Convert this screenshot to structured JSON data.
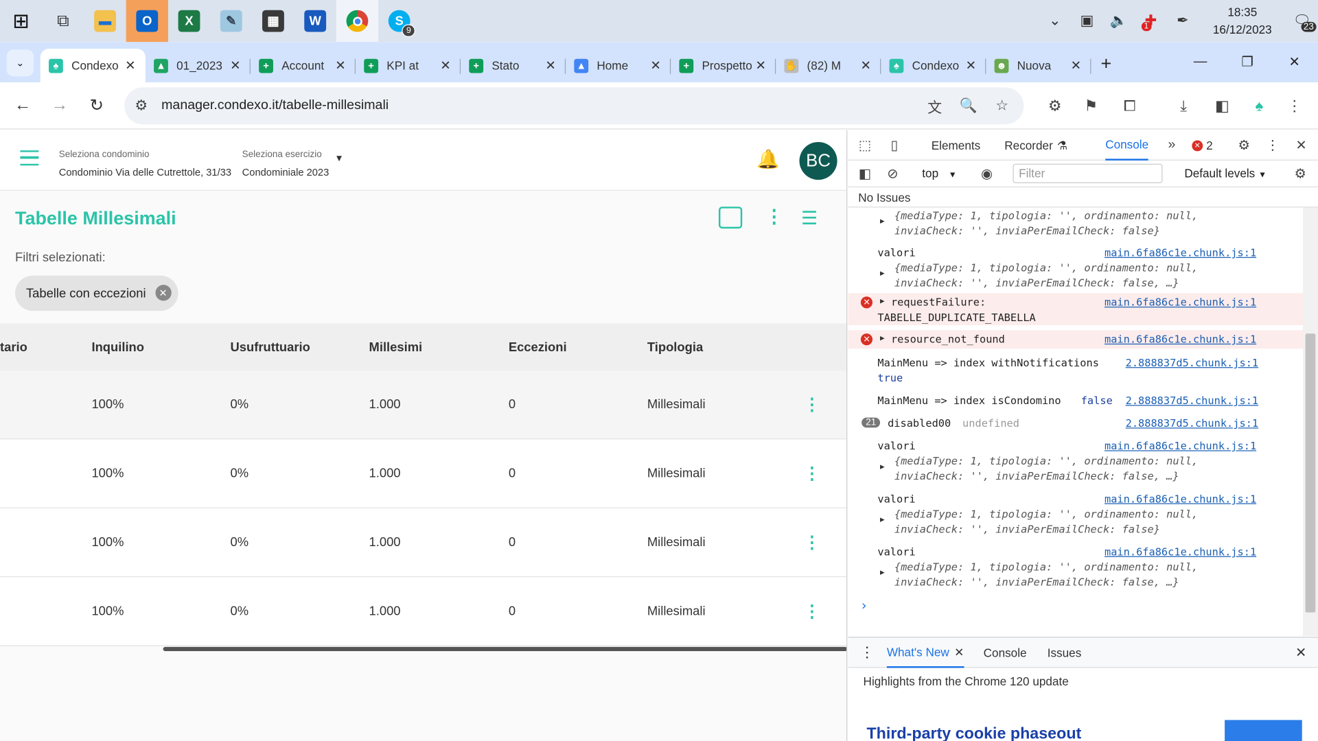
{
  "taskbar": {
    "apps": [
      {
        "name": "start",
        "glyph": "⊞"
      },
      {
        "name": "task-view",
        "glyph": "⧉"
      },
      {
        "name": "file-explorer",
        "glyph": "📁"
      },
      {
        "name": "outlook",
        "glyph": "O"
      },
      {
        "name": "excel",
        "glyph": "X"
      },
      {
        "name": "notepad",
        "glyph": "✎"
      },
      {
        "name": "calculator",
        "glyph": "▦"
      },
      {
        "name": "word",
        "glyph": "W"
      },
      {
        "name": "chrome",
        "glyph": "◉"
      },
      {
        "name": "skype",
        "glyph": "S",
        "badge": "9"
      }
    ],
    "time": "18:35",
    "date": "16/12/2023",
    "notification_count": "23",
    "mail_badge": "1"
  },
  "browser": {
    "tabs": [
      {
        "title": "Condexo",
        "color": "#2bc4a8",
        "glyph": "♠",
        "active": true
      },
      {
        "title": "01_2023",
        "color": "#1fa463",
        "glyph": "▲",
        "active": false
      },
      {
        "title": "Account",
        "color": "#0f9d58",
        "glyph": "+",
        "active": false
      },
      {
        "title": "KPI at",
        "color": "#0f9d58",
        "glyph": "+",
        "active": false
      },
      {
        "title": "Stato",
        "color": "#0f9d58",
        "glyph": "+",
        "active": false
      },
      {
        "title": "Home",
        "color": "#4285f4",
        "glyph": "▲",
        "active": false
      },
      {
        "title": "Prospetto",
        "color": "#0f9d58",
        "glyph": "+",
        "active": false
      },
      {
        "title": "(82) M",
        "color": "#bbbbbb",
        "glyph": "✋",
        "active": false
      },
      {
        "title": "Condexo",
        "color": "#2bc4a8",
        "glyph": "♠",
        "active": false
      },
      {
        "title": "Nuova",
        "color": "#6aa84f",
        "glyph": "☻",
        "active": false
      }
    ],
    "url": "manager.condexo.it/tabelle-millesimali"
  },
  "app": {
    "condominio_label": "Seleziona condominio",
    "condominio_value": "Condominio Via delle Cutrettole, 31/33",
    "esercizio_label": "Seleziona esercizio",
    "esercizio_value": "Condominiale 2023",
    "avatar": "BC",
    "title": "Tabelle Millesimali",
    "filters_label": "Filtri selezionati:",
    "chip": "Tabelle con eccezioni",
    "columns": [
      "tario",
      "Inquilino",
      "Usufruttuario",
      "Millesimi",
      "Eccezioni",
      "Tipologia"
    ],
    "rows": [
      [
        "100%",
        "0%",
        "1.000",
        "0",
        "Millesimali"
      ],
      [
        "100%",
        "0%",
        "1.000",
        "0",
        "Millesimali"
      ],
      [
        "100%",
        "0%",
        "1.000",
        "0",
        "Millesimali"
      ],
      [
        "100%",
        "0%",
        "1.000",
        "0",
        "Millesimali"
      ]
    ],
    "accent": "#2bc4a8"
  },
  "devtools": {
    "tabs": [
      "Elements",
      "Recorder",
      "Console"
    ],
    "active_tab": "Console",
    "error_count": "2",
    "context": "top",
    "filter_placeholder": "Filter",
    "levels": "Default levels",
    "no_issues": "No Issues",
    "drawer_tabs": [
      "What's New",
      "Console",
      "Issues"
    ],
    "highlights": "Highlights from the Chrome 120 update",
    "promo_title": "Third-party cookie phaseout"
  },
  "console": {
    "obj_full": "{mediaType: 1, tipologia: '', ordinamento: null, inviaCheck: '', inviaPerEmailCheck: false}",
    "obj_short": "{mediaType: 1, tipologia: '', ordinamento: null, inviaCheck: '', inviaPerEmailCheck: false, …}",
    "valori": "valori",
    "chunk_main": "main.6fa86c1e.chunk.js:1",
    "chunk_2": "2.888837d5.chunk.js:1",
    "err1_a": "requestFailure:",
    "err1_b": "TABELLE_DUPLICATE_TABELLA",
    "err2": "resource_not_found",
    "menu1": "MainMenu => index withNotifications",
    "menu1_val": "true",
    "menu2": "MainMenu => index isCondomino",
    "menu2_val": "false",
    "disabled": "disabled00",
    "disabled_val": "undefined",
    "repeat": "21",
    "prompt": "›"
  }
}
